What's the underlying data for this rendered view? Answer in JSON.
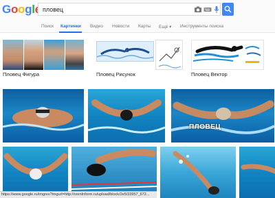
{
  "logo": {
    "letters": [
      "G",
      "o",
      "o",
      "g",
      "l",
      "e"
    ],
    "colors": [
      "#4285f4",
      "#ea4335",
      "#fbbc05",
      "#4285f4",
      "#34a853",
      "#ea4335"
    ]
  },
  "search": {
    "query": "пловец"
  },
  "tabs": [
    {
      "label": "Поиск",
      "active": false
    },
    {
      "label": "Картинки",
      "active": true
    },
    {
      "label": "Видео",
      "active": false
    },
    {
      "label": "Новости",
      "active": false
    },
    {
      "label": "Карты",
      "active": false
    },
    {
      "label": "Ещё ▾",
      "active": false
    },
    {
      "label": "Инструменты поиска",
      "active": false
    }
  ],
  "suggestions": [
    {
      "label": "Пловец Фигура"
    },
    {
      "label": "Пловец Рисунок"
    },
    {
      "label": "Пловец Вектор"
    }
  ],
  "results": {
    "watermark": "ПЛОВЕЦ"
  },
  "status_url": "https://www.google.ru/imgres?imgurl=http://orenInform.ru/upload/block/2e5/33957_672...",
  "colors": {
    "accent": "#4285f4",
    "water": "#1b86c7"
  }
}
